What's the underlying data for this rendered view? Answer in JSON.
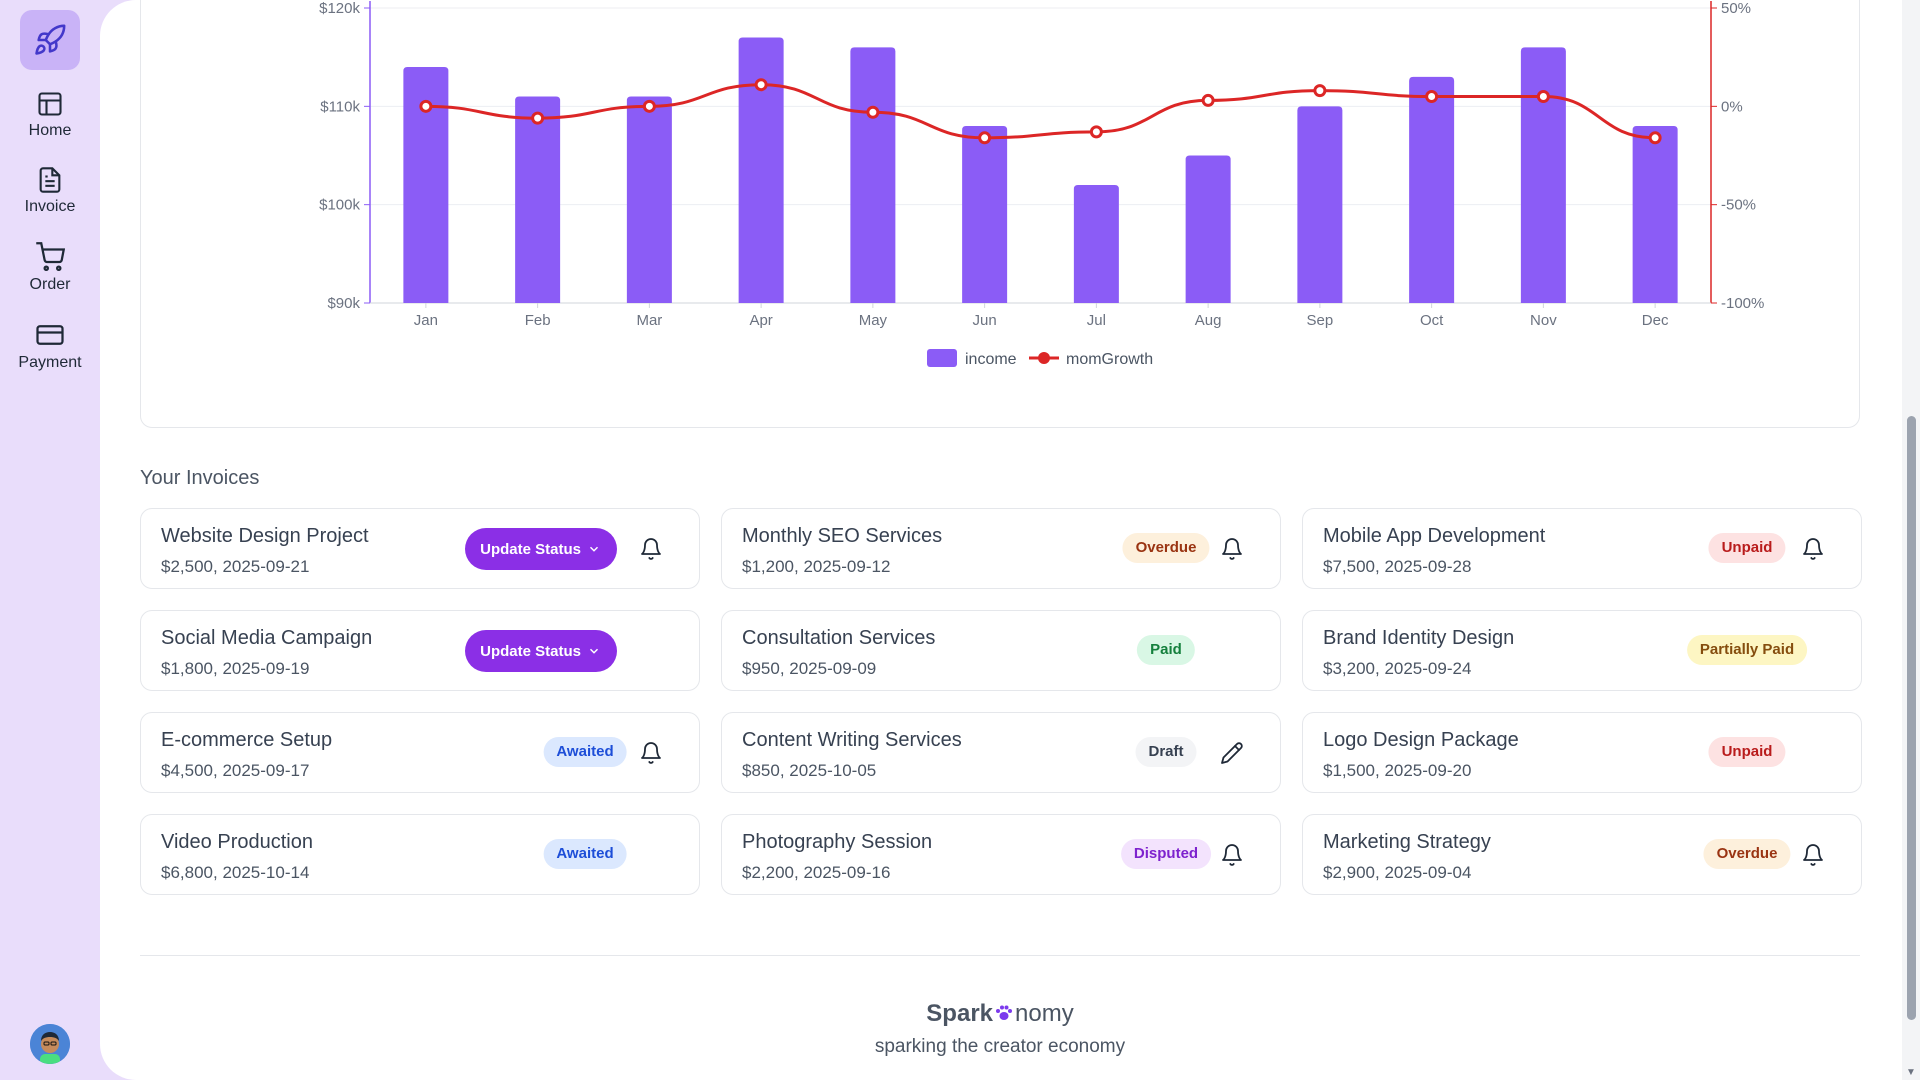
{
  "sidebar": {
    "logo_icon": "rocket-icon",
    "items": [
      {
        "label": "Home",
        "icon": "layout-icon"
      },
      {
        "label": "Invoice",
        "icon": "document-icon"
      },
      {
        "label": "Order",
        "icon": "cart-icon"
      },
      {
        "label": "Payment",
        "icon": "card-icon"
      }
    ],
    "avatar_icon": "user-avatar-icon"
  },
  "colors": {
    "accent": "#8b5cf6",
    "button": "#8b2fe6",
    "growth_line": "#dc2626",
    "sidebar_bg": "#e9ddfb"
  },
  "chart_data": {
    "type": "bar",
    "categories": [
      "Jan",
      "Feb",
      "Mar",
      "Apr",
      "May",
      "Jun",
      "Jul",
      "Aug",
      "Sep",
      "Oct",
      "Nov",
      "Dec"
    ],
    "series": [
      {
        "name": "income",
        "type": "bar",
        "axis": "left",
        "color": "#8b5cf6",
        "values": [
          114000,
          111000,
          111000,
          117000,
          116000,
          108000,
          102000,
          105000,
          110000,
          113000,
          116000,
          108000
        ]
      },
      {
        "name": "momGrowth",
        "type": "line",
        "axis": "right",
        "color": "#dc2626",
        "values": [
          0,
          -6,
          0,
          11,
          -3,
          -16,
          -13,
          3,
          8,
          5,
          5,
          -16
        ]
      }
    ],
    "y_left": {
      "ylim": [
        90000,
        120000
      ],
      "ticks": [
        "$90k",
        "$100k",
        "$110k",
        "$120k"
      ]
    },
    "y_right": {
      "ylim": [
        -100,
        50
      ],
      "ticks": [
        "-100%",
        "-50%",
        "0%",
        "50%"
      ]
    },
    "grid": true,
    "legend_placement": "bottom-center",
    "legend": [
      "income",
      "momGrowth"
    ]
  },
  "invoices_section": {
    "title": "Your Invoices"
  },
  "invoices": [
    {
      "title": "Website Design Project",
      "meta": "$2,500, 2025-09-21",
      "status": "Update Status",
      "kind": "button",
      "action": "bell-icon"
    },
    {
      "title": "Monthly SEO Services",
      "meta": "$1,200, 2025-09-12",
      "status": "Overdue",
      "kind": "overdue",
      "action": "bell-icon"
    },
    {
      "title": "Mobile App Development",
      "meta": "$7,500, 2025-09-28",
      "status": "Unpaid",
      "kind": "unpaid",
      "action": "bell-icon"
    },
    {
      "title": "Social Media Campaign",
      "meta": "$1,800, 2025-09-19",
      "status": "Update Status",
      "kind": "button",
      "action": ""
    },
    {
      "title": "Consultation Services",
      "meta": "$950, 2025-09-09",
      "status": "Paid",
      "kind": "paid",
      "action": ""
    },
    {
      "title": "Brand Identity Design",
      "meta": "$3,200, 2025-09-24",
      "status": "Partially Paid",
      "kind": "partial",
      "action": ""
    },
    {
      "title": "E-commerce Setup",
      "meta": "$4,500, 2025-09-17",
      "status": "Awaited",
      "kind": "awaited",
      "action": "bell-icon"
    },
    {
      "title": "Content Writing Services",
      "meta": "$850, 2025-10-05",
      "status": "Draft",
      "kind": "draft",
      "action": "pencil-icon"
    },
    {
      "title": "Logo Design Package",
      "meta": "$1,500, 2025-09-20",
      "status": "Unpaid",
      "kind": "unpaid",
      "action": ""
    },
    {
      "title": "Video Production",
      "meta": "$6,800, 2025-10-14",
      "status": "Awaited",
      "kind": "awaited",
      "action": ""
    },
    {
      "title": "Photography Session",
      "meta": "$2,200, 2025-09-16",
      "status": "Disputed",
      "kind": "disputed",
      "action": "bell-icon"
    },
    {
      "title": "Marketing Strategy",
      "meta": "$2,900, 2025-09-04",
      "status": "Overdue",
      "kind": "overdue",
      "action": "bell-icon"
    }
  ],
  "status_styles": {
    "overdue": {
      "bg": "#fdf0dc",
      "fg": "#9a3412"
    },
    "unpaid": {
      "bg": "#fde2e2",
      "fg": "#b91c1c"
    },
    "paid": {
      "bg": "#d9f7e5",
      "fg": "#15803d"
    },
    "partial": {
      "bg": "#fdf6c3",
      "fg": "#854d0e"
    },
    "awaited": {
      "bg": "#dbe8fe",
      "fg": "#1d4ed8"
    },
    "draft": {
      "bg": "#f3f4f6",
      "fg": "#374151"
    },
    "disputed": {
      "bg": "#f3e3fd",
      "fg": "#7e22ce"
    }
  },
  "footer": {
    "brand_left": "Spark",
    "brand_right": "nomy",
    "brand_icon": "paw-icon",
    "tagline": "sparking the creator economy"
  }
}
